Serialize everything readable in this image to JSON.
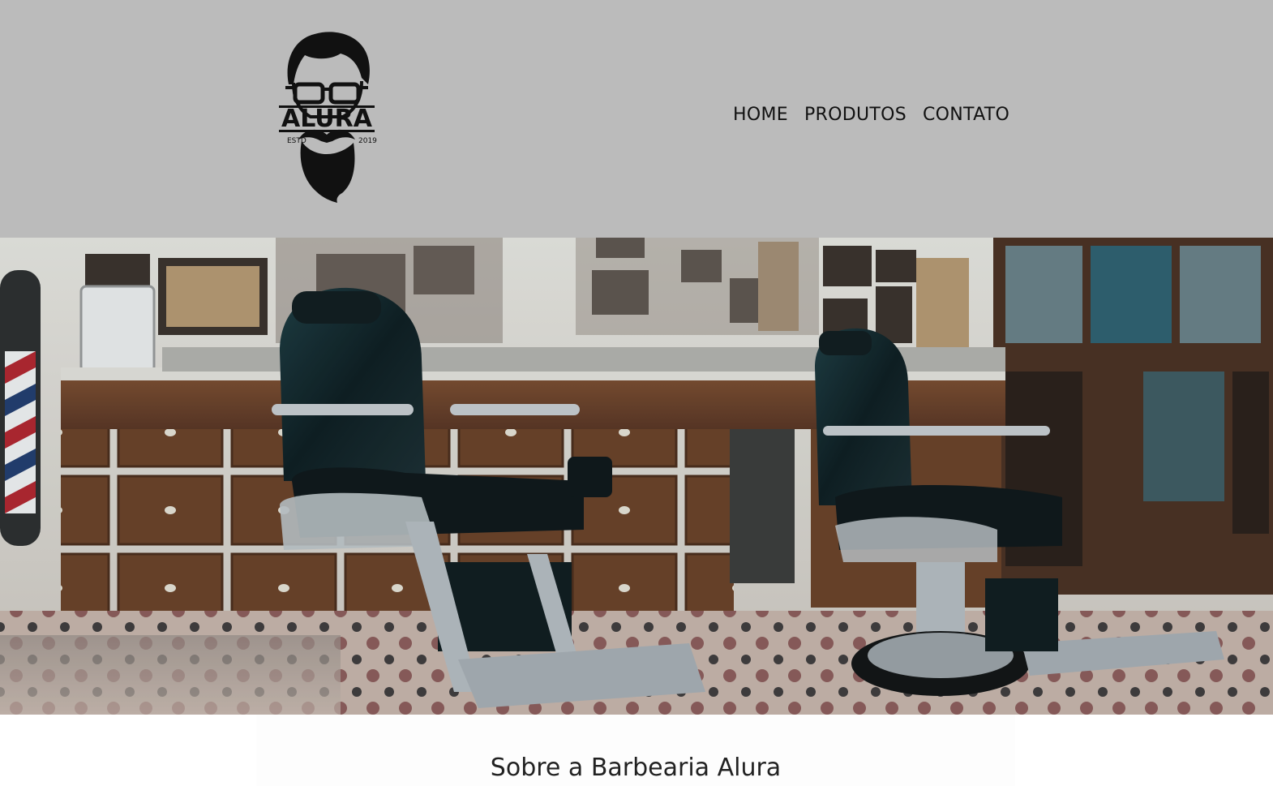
{
  "header": {
    "logo": {
      "wordmark": "ALURA",
      "left_text": "ESTD",
      "right_text": "2019",
      "icon": "bearded-man-glasses-logo"
    },
    "nav": [
      {
        "label": "HOME"
      },
      {
        "label": "PRODUTOS"
      },
      {
        "label": "CONTATO"
      }
    ],
    "background_color": "#bbbbbb"
  },
  "hero": {
    "image": "barbershop-interior-photo"
  },
  "about": {
    "title": "Sobre a Barbearia Alura"
  }
}
